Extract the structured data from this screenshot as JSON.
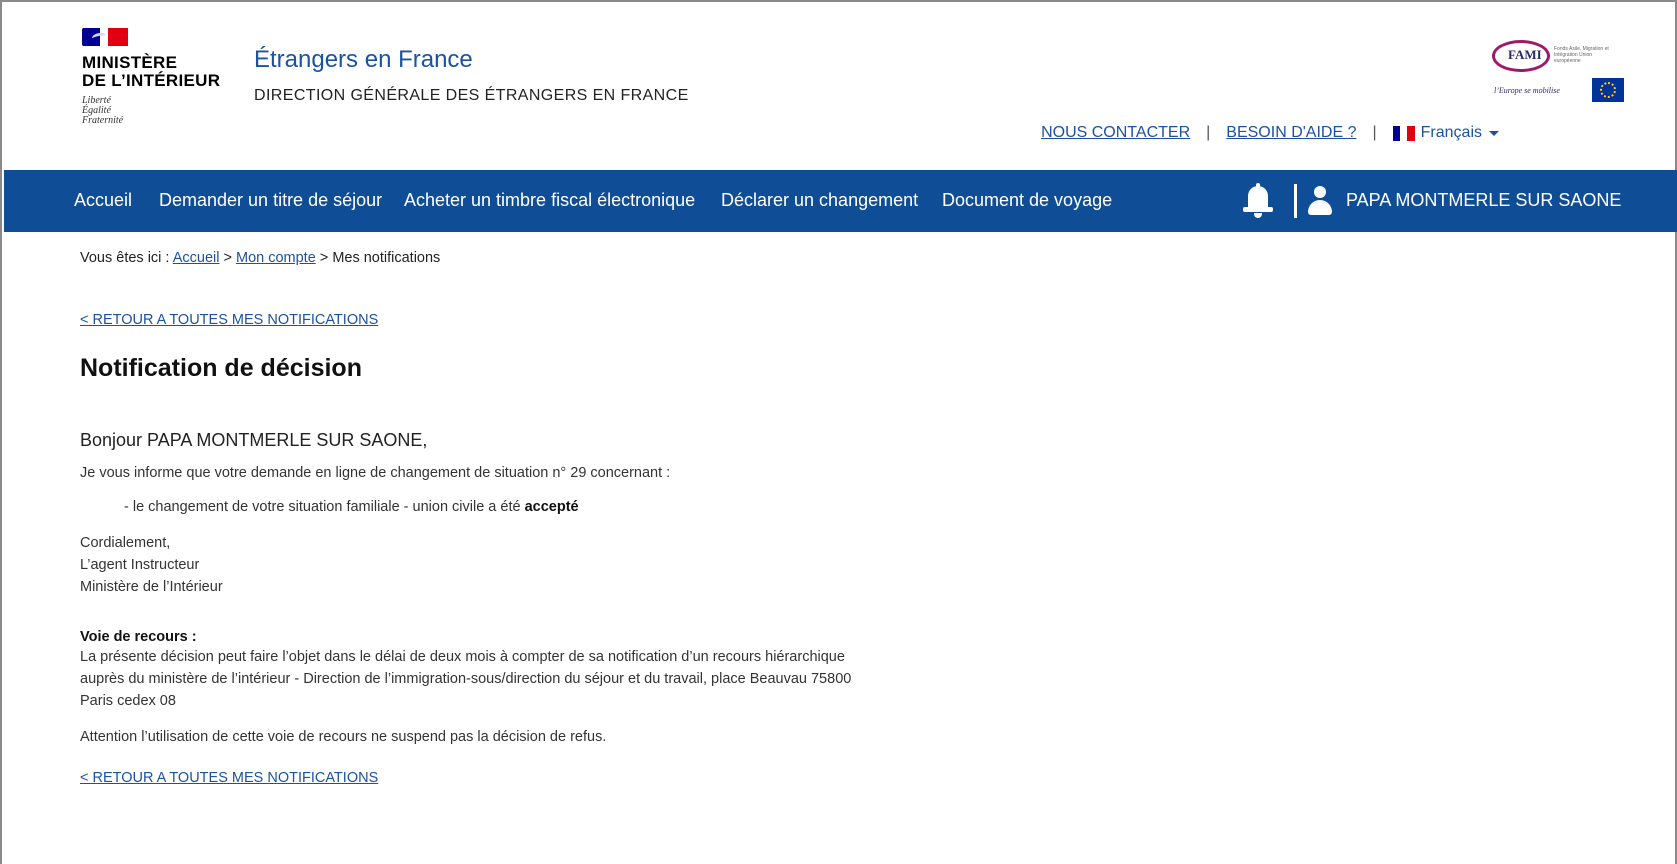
{
  "header": {
    "logo": {
      "line1": "MINISTÈRE",
      "line2": "DE L’INTÉRIEUR",
      "motto1": "Liberté",
      "motto2": "Égalité",
      "motto3": "Fraternité"
    },
    "site_title": "Étrangers en France",
    "site_subtitle": "DIRECTION GÉNÉRALE DES ÉTRANGERS EN FRANCE",
    "fami": {
      "label": "FAMI",
      "small": "Fonds Asile, Migration et Intégration Union européenne",
      "tagline": "l’Europe se mobilise"
    },
    "links": {
      "contact": "NOUS CONTACTER",
      "help": "BESOIN D'AIDE ?",
      "separator": "|",
      "language": "Français"
    }
  },
  "nav": {
    "items": [
      "Accueil",
      "Demander un titre de séjour",
      "Acheter un timbre fiscal électronique",
      "Déclarer un changement",
      "Document de voyage"
    ],
    "user_name": "PAPA MONTMERLE SUR SAONE",
    "icons": {
      "bell": "bell-icon",
      "user": "user-icon"
    }
  },
  "breadcrumb": {
    "prefix": "Vous êtes ici : ",
    "home": "Accueil",
    "sep": " > ",
    "account": "Mon compte",
    "current": "Mes notifications"
  },
  "back_link": "< RETOUR A TOUTES MES NOTIFICATIONS",
  "notification": {
    "title": "Notification de décision",
    "greeting": "Bonjour PAPA MONTMERLE SUR SAONE,",
    "intro": "Je vous informe que votre demande en ligne de changement de situation n° 29 concernant :",
    "item_prefix": "- le changement de votre situation familiale - union civile a été ",
    "item_status": "accepté",
    "closing1": "Cordialement,",
    "closing2": "L’agent Instructeur",
    "closing3": "Ministère de l’Intérieur",
    "recours_title": "Voie de recours :",
    "recours1": "La présente décision peut faire l’objet dans le délai de deux mois à compter de sa notification d’un recours hiérarchique",
    "recours2": "auprès du ministère de l’intérieur - Direction de l’immigration-sous/direction du séjour et du travail, place Beauvau 75800",
    "recours3": "Paris cedex 08",
    "attention": "Attention l’utilisation de cette voie de recours ne suspend pas la décision de refus."
  },
  "colors": {
    "brand_blue": "#0f4e96",
    "link_blue": "#1c52a0",
    "marianne_blue": "#000091",
    "marianne_red": "#e1000f"
  }
}
